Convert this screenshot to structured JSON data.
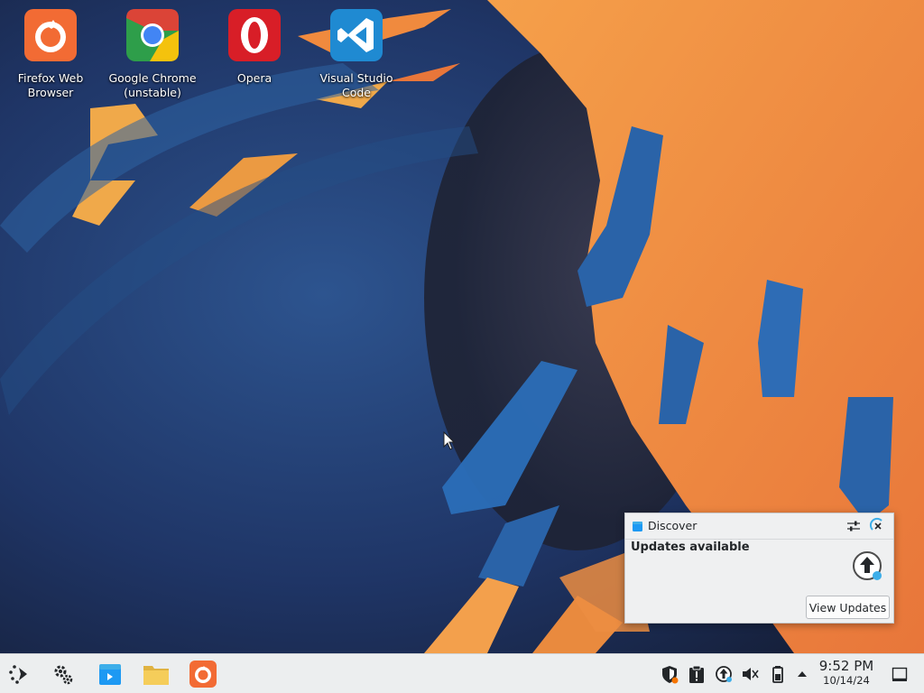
{
  "desktop": {
    "icons": [
      {
        "label": "Firefox Web\nBrowser",
        "icon": "firefox-icon"
      },
      {
        "label": "Google Chrome\n(unstable)",
        "icon": "chrome-icon"
      },
      {
        "label": "Opera",
        "icon": "opera-icon"
      },
      {
        "label": "Visual Studio\nCode",
        "icon": "vscode-icon"
      }
    ]
  },
  "notification": {
    "app_name": "Discover",
    "title": "Updates available",
    "action_label": "View Updates",
    "icons": [
      "discover-icon",
      "settings-sliders-icon",
      "close-icon",
      "update-arrow-icon"
    ]
  },
  "taskbar": {
    "launchers": [
      "application-launcher-icon",
      "system-settings-icon",
      "discover-icon",
      "file-manager-icon",
      "firefox-icon"
    ],
    "tray": [
      "vault-icon",
      "clipboard-icon",
      "updates-icon",
      "volume-muted-icon",
      "battery-icon",
      "expand-tray-icon"
    ],
    "clock": {
      "time": "9:52 PM",
      "date": "10/14/24"
    },
    "show_desktop": "show-desktop-icon"
  },
  "colors": {
    "taskbar_bg": "#eceeef",
    "notification_bg": "#eff0f1",
    "accent_blue": "#1d99f3",
    "wallpaper_orange": "#f08a3e",
    "wallpaper_blue": "#2a62a8"
  }
}
